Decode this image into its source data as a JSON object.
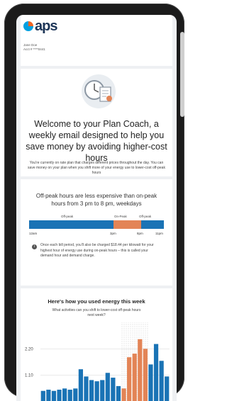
{
  "brand": {
    "name": "aps",
    "accent": "#f26522",
    "blue": "#00a0e0",
    "navy": "#1d3557"
  },
  "header": {
    "user_name": "Jane Doe",
    "account": "Acct # ****0441"
  },
  "hero": {
    "title": "Welcome to your Plan Coach, a weekly email designed to help you save money by avoiding higher-cost hours",
    "subtitle": "You're currently on rate plan that charges different prices throughout the day. You can save money on your plan when you shift more of your energy use to lower-cost off-peak hours"
  },
  "offpeak": {
    "title": "Off-peak hours are less expensive than on-peak hours from 3 pm to 8 pm, weekdays",
    "segments": [
      {
        "label": "Off-peak",
        "start": 0,
        "end": 15,
        "color": "#1a73b5"
      },
      {
        "label": "On-Peak",
        "start": 15,
        "end": 20,
        "color": "#e38456"
      },
      {
        "label": "Off-peak",
        "start": 20,
        "end": 24,
        "color": "#1a73b5"
      }
    ],
    "time_labels": [
      "12am",
      "3pm",
      "8pm",
      "11pm"
    ],
    "info_text": "Once each bill period, you'll also be charged $18.44 per kilowatt for your highest hour of energy use during on-peak hours – this is called your demand hour and demand charge."
  },
  "usage": {
    "title": "Here's how you used energy this week",
    "subtitle": "What activities can you shift to lower-cost off-peak hours next week?"
  },
  "chart_data": {
    "type": "bar",
    "title": "Here's how you used energy this week",
    "xlabel": "",
    "ylabel": "",
    "ylim": [
      0,
      3.3
    ],
    "yticks": [
      "2.20",
      "1.10"
    ],
    "ytick_values": [
      2.2,
      1.1
    ],
    "grid": true,
    "values": [
      0.45,
      0.5,
      0.45,
      0.5,
      0.55,
      0.5,
      0.55,
      1.35,
      1.05,
      0.9,
      0.85,
      0.9,
      1.2,
      1.0,
      0.65,
      0.55,
      1.85,
      2.0,
      2.6,
      2.2,
      1.55,
      2.4,
      1.7,
      1.05
    ],
    "peak_start_index": 15,
    "peak_end_index": 20,
    "offpeak_color": "#1a73b5",
    "onpeak_color": "#e38456"
  }
}
